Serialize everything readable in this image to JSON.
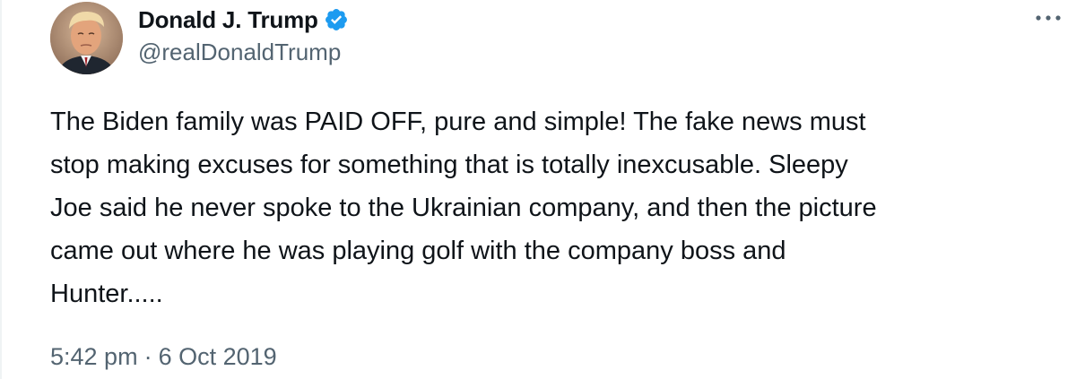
{
  "tweet": {
    "author": {
      "display_name": "Donald J. Trump",
      "handle": "@realDonaldTrump",
      "verified": true,
      "avatar_icon": "profile-photo"
    },
    "more_icon": "more-horizontal-icon",
    "text": "The Biden family was PAID OFF, pure and simple! The fake news must\nstop making excuses for something that is totally inexcusable. Sleepy\nJoe said he never spoke to the Ukrainian company, and then the picture\ncame out where he was playing golf with the company boss and\nHunter.....",
    "time": "5:42 pm",
    "separator": "·",
    "date": "6 Oct 2019"
  },
  "colors": {
    "text_primary": "#0f1419",
    "text_secondary": "#536471",
    "verified_blue": "#1d9bf0"
  }
}
